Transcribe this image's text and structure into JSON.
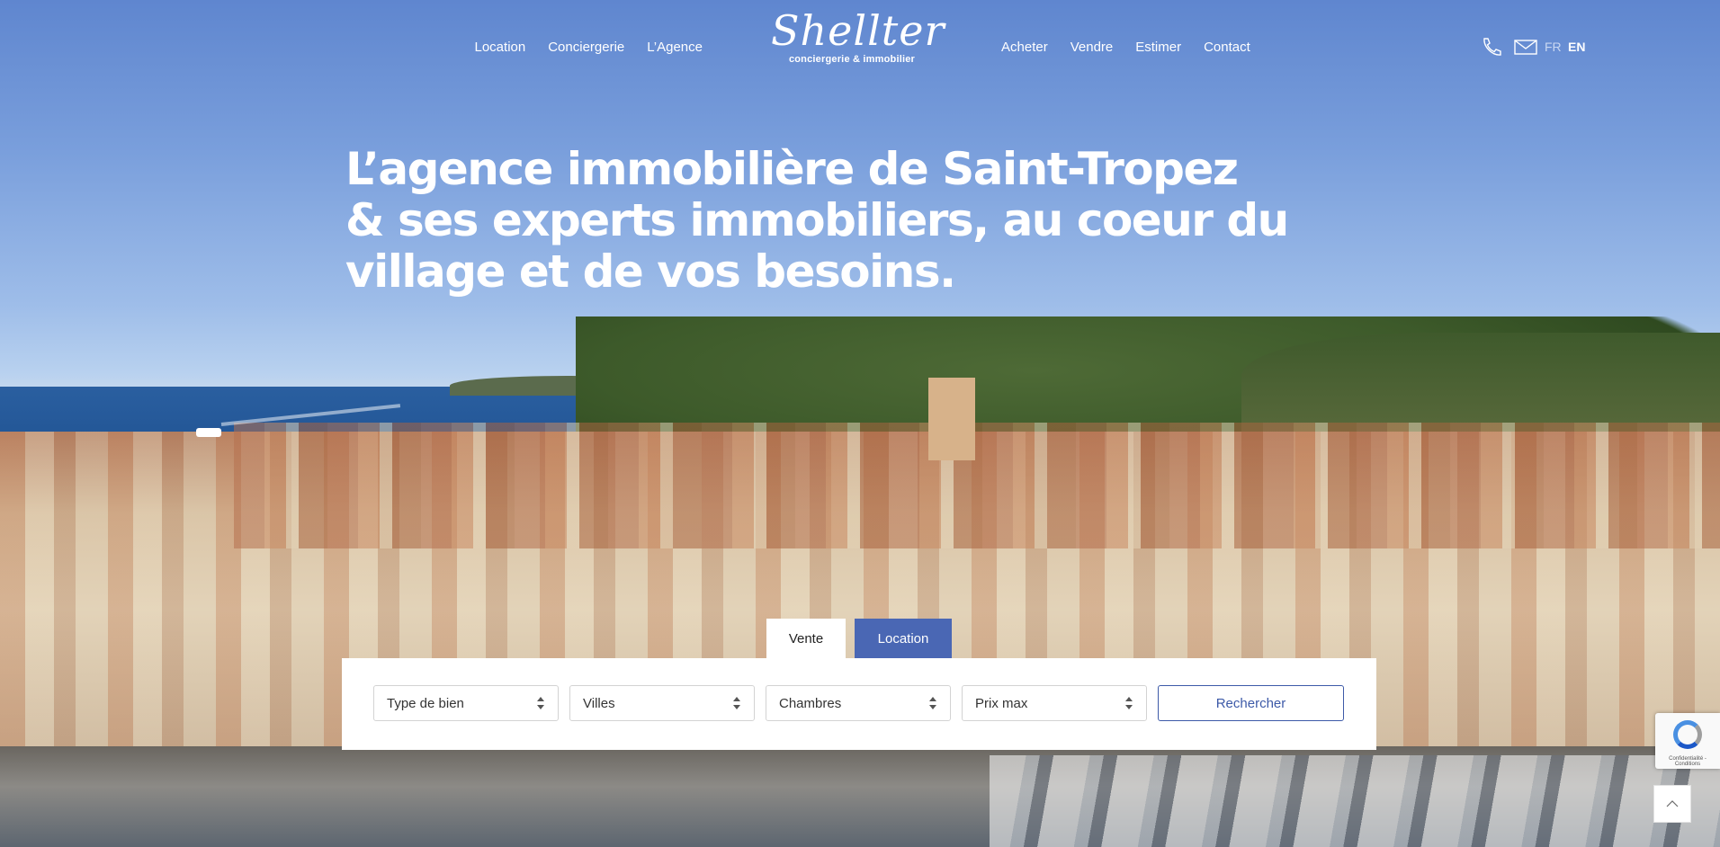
{
  "nav": {
    "left_items": [
      "Location",
      "Conciergerie",
      "L’Agence"
    ],
    "right_items": [
      "Acheter",
      "Vendre",
      "Estimer",
      "Contact"
    ],
    "phone_icon": "phone-icon",
    "mail_icon": "mail-icon",
    "languages": {
      "fr": "FR",
      "en": "EN"
    }
  },
  "logo": {
    "script": "Shellter",
    "tagline": "conciergerie & immobilier"
  },
  "hero": {
    "headline_lines": [
      "L’agence immobilière de Saint-Tropez",
      "& ses experts immobiliers, au coeur du",
      "village et de vos besoins."
    ]
  },
  "search": {
    "tabs": {
      "vente": "Vente",
      "location": "Location"
    },
    "active_tab": "Location",
    "fields": {
      "type": "Type de bien",
      "villes": "Villes",
      "chambres": "Chambres",
      "prix": "Prix max"
    },
    "submit": "Rechercher"
  },
  "recaptcha": {
    "text": "Confidentialité - Conditions"
  },
  "colors": {
    "accent": "#4a67b4",
    "button_border": "#3d5aa8"
  }
}
